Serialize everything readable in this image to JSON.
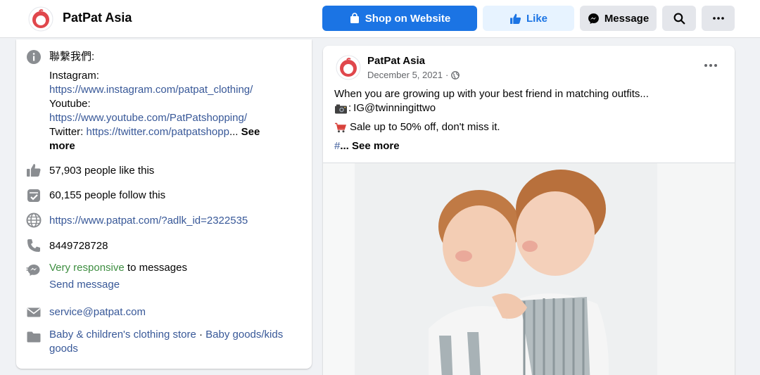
{
  "page": {
    "name": "PatPat Asia",
    "buttons": {
      "shop": "Shop on Website",
      "like": "Like",
      "message": "Message"
    }
  },
  "about": {
    "contact_heading": "聯繫我們:",
    "instagram_label": "Instagram:",
    "instagram_url": "https://www.instagram.com/patpat_clothing/",
    "youtube_label": "Youtube:",
    "youtube_url": "https://www.youtube.com/PatPatshopping/",
    "twitter_label": "Twitter:",
    "twitter_url": "https://twitter.com/patpatshopp",
    "ellipsis": "...",
    "see_more_1": "See",
    "see_more_2": "more",
    "likes": "57,903 people like this",
    "follows": "60,155 people follow this",
    "website": "https://www.patpat.com/?adlk_id=2322535",
    "phone": "8449728728",
    "responsive_highlight": "Very responsive",
    "responsive_rest": "to messages",
    "send_message": "Send message",
    "email": "service@patpat.com",
    "category_1": "Baby & children's clothing store",
    "category_sep": "·",
    "category_2a": "Baby goods/kids",
    "category_2b": "goods"
  },
  "post": {
    "author": "PatPat Asia",
    "date": "December 5, 2021",
    "date_sep": "·",
    "line1": "When you are growing up with your best friend in matching outfits...",
    "line2": "IG@twinningittwo",
    "line3": "Sale up to 50% off, don't miss it.",
    "hash": "#",
    "see_more": "... See more"
  },
  "colors": {
    "brand_blue": "#1b74e4",
    "link": "#385898",
    "responsive_green": "#3e8e41",
    "logo_red": "#e0474c"
  },
  "icons": [
    "patpat-logo-icon",
    "shopping-bag-icon",
    "thumbs-up-icon",
    "messenger-icon",
    "search-icon",
    "more-dots-icon",
    "info-icon",
    "like-icon",
    "follow-icon",
    "globe-icon",
    "phone-icon",
    "responsive-icon",
    "email-icon",
    "category-icon",
    "camera-icon",
    "cart-icon"
  ]
}
